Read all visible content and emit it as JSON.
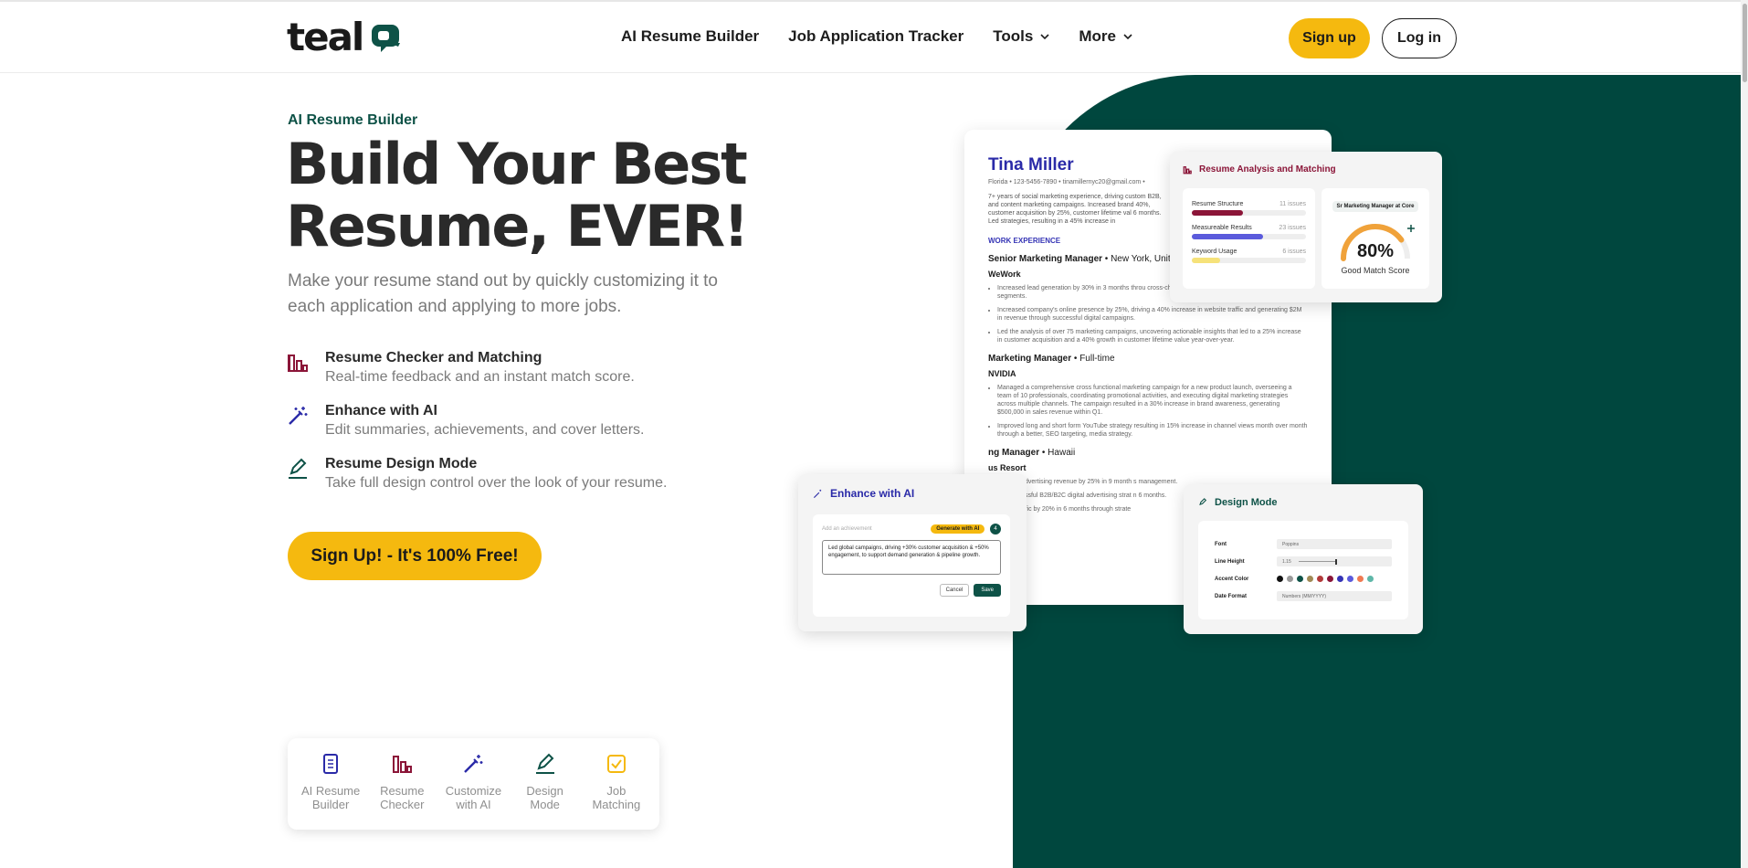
{
  "nav": {
    "logo_text": "teal",
    "links": [
      {
        "label": "AI Resume Builder"
      },
      {
        "label": "Job Application Tracker"
      },
      {
        "label": "Tools"
      },
      {
        "label": "More"
      }
    ],
    "signup_label": "Sign up",
    "login_label": "Log in"
  },
  "hero": {
    "eyebrow": "AI Resume Builder",
    "title_line1": "Build Your Best",
    "title_line2": "Resume, EVER!",
    "subtitle": "Make your resume stand out by quickly customizing it to each application and applying to more jobs.",
    "features": [
      {
        "title": "Resume Checker and Matching",
        "desc": "Real-time feedback and an instant match score.",
        "icon": "bar-chart-icon"
      },
      {
        "title": "Enhance with AI",
        "desc": "Edit summaries, achievements, and cover letters.",
        "icon": "magic-wand-icon"
      },
      {
        "title": "Resume Design Mode",
        "desc": "Take full design control over the look of your resume.",
        "icon": "pencil-icon"
      }
    ],
    "cta_label": "Sign Up! - It's 100% Free!"
  },
  "tabs": [
    {
      "line1": "AI Resume",
      "line2": "Builder",
      "icon": "document-icon"
    },
    {
      "line1": "Resume",
      "line2": "Checker",
      "icon": "bar-chart-icon"
    },
    {
      "line1": "Customize",
      "line2": "with AI",
      "icon": "magic-wand-icon"
    },
    {
      "line1": "Design",
      "line2": "Mode",
      "icon": "pencil-icon"
    },
    {
      "line1": "Job",
      "line2": "Matching",
      "icon": "checkbox-icon"
    }
  ],
  "resume": {
    "name": "Tina Miller",
    "contact": "Florida • 123-5456-7890 • tinamillernyc20@gmail.com •",
    "summary": "7+ years of social marketing experience, driving custom B2B, and content marketing campaigns. Increased brand 40%, customer acquisition by 25%, customer lifetime val 6 months. Led strategies, resulting in a 45% increase in",
    "section": "WORK EXPERIENCE",
    "jobs": [
      {
        "role": "Senior Marketing Manager",
        "meta": " • New York, United",
        "company": "WeWork",
        "bullets": [
          "Increased lead generation by 30% in 3 months throu cross-channel campaigns targeting key customer segments.",
          "Increased company's online presence by 25%, driving a 40% increase in website traffic and generating $2M in revenue through successful digital campaigns.",
          "Led the analysis of over 75 marketing campaigns, uncovering actionable insights that led to a 25% increase in customer acquisition and a 40% growth in customer lifetime value year-over-year."
        ]
      },
      {
        "role": "Marketing Manager",
        "meta": " • Full-time",
        "company": "NVIDIA",
        "bullets": [
          "Managed a comprehensive cross functional marketing campaign for a new product launch, overseeing a team of 10 professionals, coordinating promotional activities, and executing digital marketing strategies across multiple channels. The campaign resulted in a 30% increase in brand awareness, generating $500,000 in sales revenue within Q1.",
          "Improved long and short form YouTube strategy resulting in 15% increase in channel views month over month through a better, SEO targeting, media strategy."
        ]
      },
      {
        "role": "ng Manager",
        "meta": " • Hawaii",
        "company": "us Resort",
        "bullets": [
          "d digital advertising revenue by 25% in 9 month s management.",
          "d a successful B2B/B2C digital advertising strat n 6 months.",
          "d web traffic by 20% in 6 months through strate"
        ]
      }
    ]
  },
  "analysis": {
    "title": "Resume Analysis and Matching",
    "rows": [
      {
        "label": "Resume Structure",
        "count": "11 issues",
        "fill": 0.45,
        "color": "#8b1538"
      },
      {
        "label": "Measureable Results",
        "count": "23 issues",
        "fill": 0.62,
        "color": "#5b5bdc"
      },
      {
        "label": "Keyword Usage",
        "count": "6 issues",
        "fill": 0.25,
        "color": "#f6e27a"
      }
    ],
    "badge": "Sr Marketing Manager at Core",
    "score": "80%",
    "score_fraction": 0.8,
    "score_label": "Good Match Score"
  },
  "enhance": {
    "title": "Enhance with AI",
    "placeholder": "Add an achievement",
    "generate_label": "Generate with AI",
    "count": "4",
    "text": "Led global campaigns, driving +30% customer acquisition & +50% engagement, to support demand generation & pipeline growth.",
    "cancel_label": "Cancel",
    "save_label": "Save"
  },
  "design": {
    "title": "Design Mode",
    "rows": [
      {
        "key": "Font",
        "value": "Poppins"
      },
      {
        "key": "Line Height",
        "value": "1.15"
      },
      {
        "key": "Accent Color",
        "value": ""
      },
      {
        "key": "Date Format",
        "value": "Numbers (MM/YYYY)"
      }
    ],
    "swatches": [
      "#111111",
      "#9a9a9a",
      "#0e5247",
      "#a08a55",
      "#b23a3a",
      "#8b1538",
      "#3534b5",
      "#5b5bdc",
      "#f07a52",
      "#5fb7a8"
    ]
  },
  "colors": {
    "brand_green": "#00473e",
    "accent_yellow": "#f5b90f",
    "maroon": "#8b1538",
    "indigo": "#2a2aa8"
  }
}
